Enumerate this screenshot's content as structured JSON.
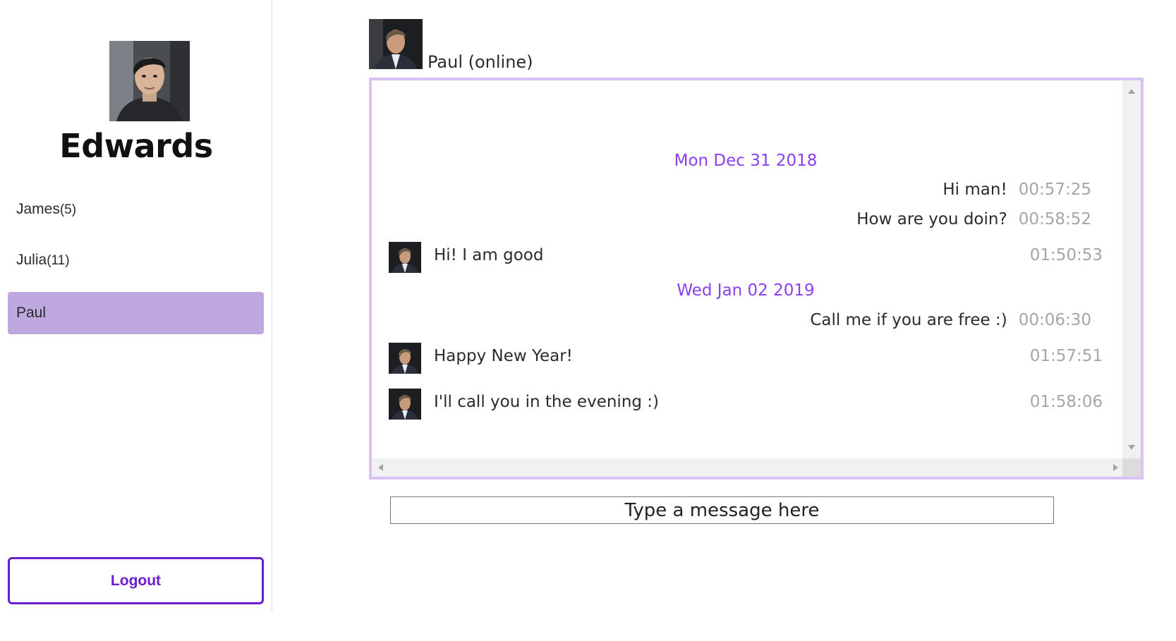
{
  "sidebar": {
    "user_name": "Edwards",
    "contacts": [
      {
        "name": "James",
        "badge": "(5)"
      },
      {
        "name": "Julia",
        "badge": "(11)"
      },
      {
        "name": "Paul",
        "badge": ""
      }
    ],
    "active_contact": "Paul",
    "logout_label": "Logout"
  },
  "chat": {
    "header": "Paul (online)",
    "messages": [
      {
        "type": "date",
        "text": "Mon Dec 31 2018"
      },
      {
        "type": "out",
        "text": "Hi man!",
        "time": "00:57:25"
      },
      {
        "type": "out",
        "text": "How are you doin?",
        "time": "00:58:52"
      },
      {
        "type": "in",
        "text": "Hi! I am good",
        "time": "01:50:53"
      },
      {
        "type": "date",
        "text": "Wed Jan 02 2019"
      },
      {
        "type": "out",
        "text": "Call me if you are free :)",
        "time": "00:06:30"
      },
      {
        "type": "in",
        "text": "Happy New Year!",
        "time": "01:57:51"
      },
      {
        "type": "in",
        "text": "I'll call you in the evening :)",
        "time": "01:58:06"
      }
    ]
  },
  "input": {
    "placeholder": "Type a message here"
  },
  "colors": {
    "accent": "#6a1ed0",
    "active_contact_bg": "#bfa7e0",
    "date_text": "#8a3ff0",
    "chat_border": "#d9c3f6"
  }
}
